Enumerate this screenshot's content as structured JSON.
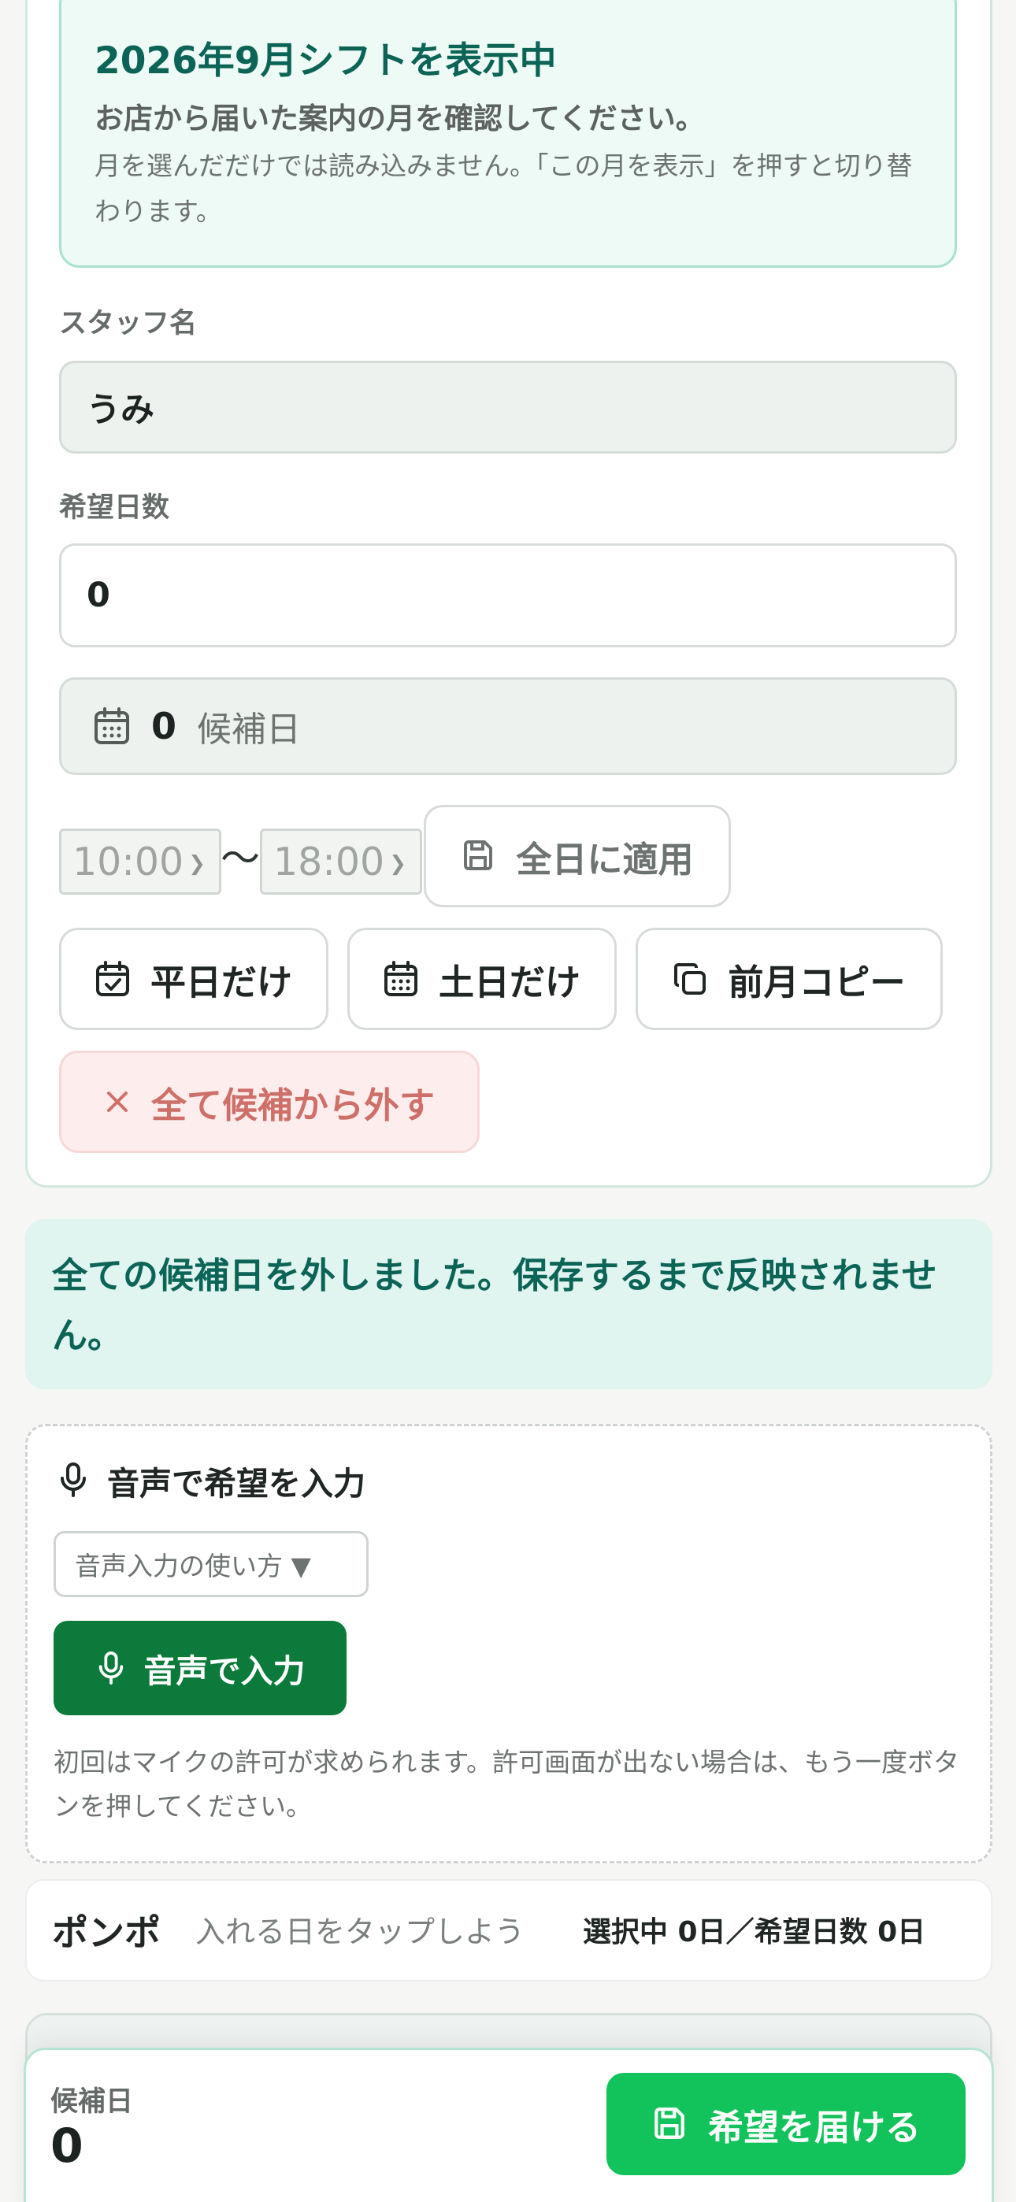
{
  "month_info": {
    "title": "2026年9月シフトを表示中",
    "subtitle": "お店から届いた案内の月を確認してください。",
    "note": "月を選んだだけでは読み込みません。「この月を表示」を押すと切り替わります。"
  },
  "staff": {
    "label": "スタッフ名",
    "value": "うみ"
  },
  "desired_days": {
    "label": "希望日数",
    "value": "0"
  },
  "candidates": {
    "count": "0",
    "unit": "候補日"
  },
  "time_range": {
    "start": "10:00",
    "separator": "〜",
    "end": "18:00",
    "apply_label": "全日に適用"
  },
  "quick_buttons": {
    "weekdays": "平日だけ",
    "weekends": "土日だけ",
    "copy_prev": "前月コピー",
    "clear_all": "全て候補から外す"
  },
  "notice": {
    "message": "全ての候補日を外しました。保存するまで反映されません。"
  },
  "voice": {
    "title": "音声で希望を入力",
    "howto": "音声入力の使い方 ▼",
    "button": "音声で入力",
    "note": "初回はマイクの許可が求められます。許可画面が出ない場合は、もう一度ボタンを押してください。"
  },
  "calendar_header": {
    "title": "ポンポ",
    "hint": "入れる日をタップしよう",
    "selection": "選択中 0日／希望日数 0日"
  },
  "bottom_bar": {
    "label": "候補日",
    "value": "0",
    "submit": "希望を届ける"
  },
  "colors": {
    "accent_dark": "#0b6455",
    "primary_green": "#12c25a",
    "voice_green": "#0b7a3a",
    "danger_text": "#cf6f69",
    "notice_bg": "#e0f4f0"
  }
}
